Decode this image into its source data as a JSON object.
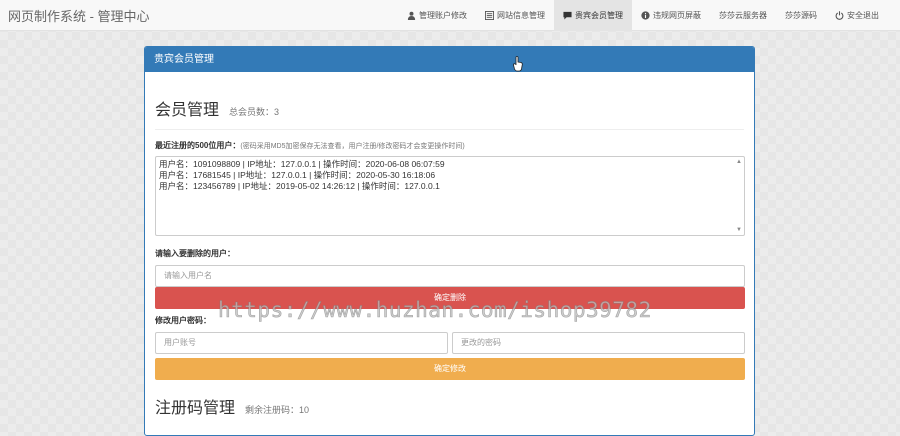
{
  "app": {
    "title": "网页制作系统 - 管理中心"
  },
  "nav": {
    "items": [
      {
        "label": "管理账户修改",
        "icon": "user-icon",
        "active": false
      },
      {
        "label": "网站信息管理",
        "icon": "list-icon",
        "active": false
      },
      {
        "label": "贵宾会员管理",
        "icon": "comment-icon",
        "active": true
      },
      {
        "label": "违规网页屏蔽",
        "icon": "info-circle-icon",
        "active": false
      },
      {
        "label": "莎莎云服务器",
        "icon": "",
        "active": false
      },
      {
        "label": "莎莎源码",
        "icon": "",
        "active": false
      },
      {
        "label": "安全退出",
        "icon": "power-icon",
        "active": false
      }
    ]
  },
  "panel": {
    "heading": "贵宾会员管理",
    "members": {
      "title": "会员管理",
      "count_text": "总会员数：3",
      "recent_label": "最近注册的500位用户：",
      "recent_note": "(密码采用MD5加密保存无法查看，用户注册/修改密码才会变更操作时间)",
      "log_lines": [
        "用户名：1091098809  |  IP地址：127.0.0.1  |  操作时间：2020-06-08 06:07:59",
        "用户名：17681545  |  IP地址：127.0.0.1  |  操作时间：2020-05-30 16:18:06",
        "用户名：123456789  |  IP地址：2019-05-02 14:26:12  |  操作时间：127.0.0.1"
      ]
    },
    "delete": {
      "label": "请输入要删除的用户：",
      "placeholder": "请输入用户名",
      "button": "确定删除"
    },
    "password": {
      "label": "修改用户密码：",
      "account_placeholder": "用户账号",
      "password_placeholder": "更改的密码",
      "button": "确定修改"
    },
    "regcode": {
      "title": "注册码管理",
      "remaining_text": "剩余注册码：10"
    }
  },
  "watermark": "https://www.huzhan.com/ishop39782",
  "colors": {
    "primary": "#337ab7",
    "danger": "#d9534f",
    "warning": "#f0ad4e"
  }
}
